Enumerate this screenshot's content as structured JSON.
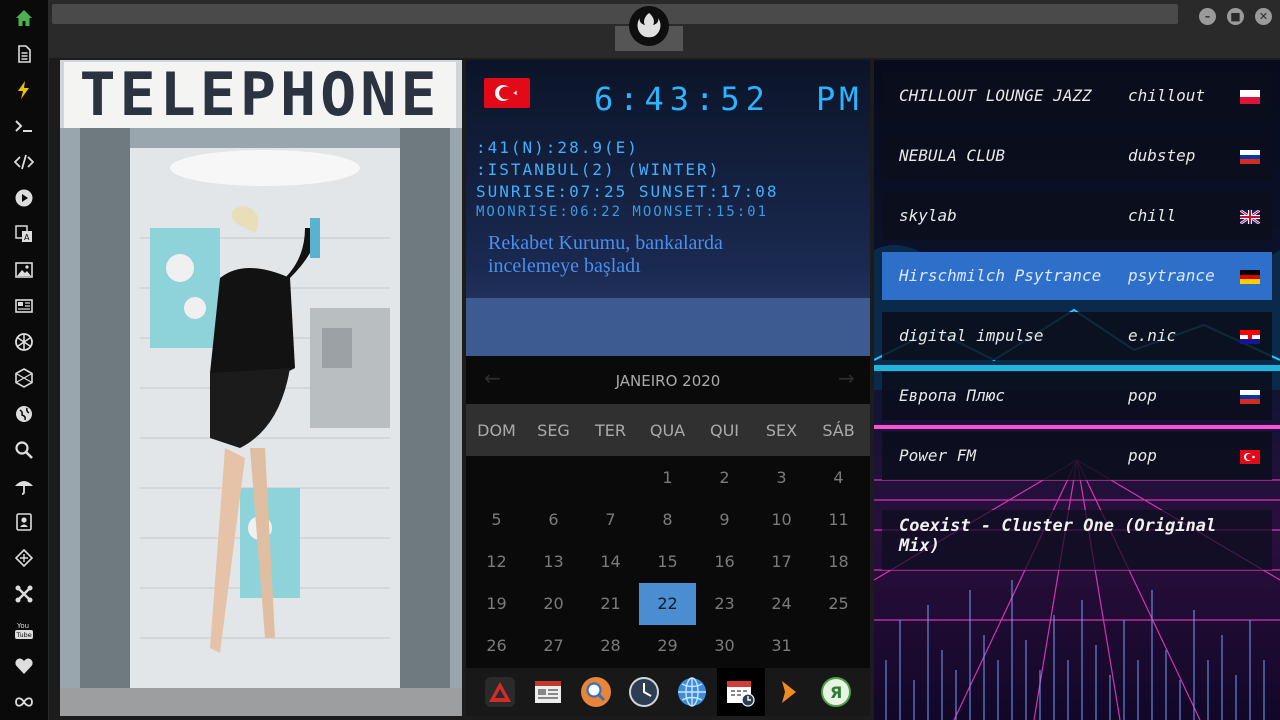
{
  "sidebar": {
    "icons": [
      "home-icon",
      "document-icon",
      "lightning-icon",
      "terminal-icon",
      "code-icon",
      "play-icon",
      "translate-icon",
      "image-icon",
      "news-icon",
      "rebel-icon",
      "hexagon-icon",
      "globe-icon",
      "search-icon",
      "umbrella-icon",
      "contacts-icon",
      "network-icon",
      "tools-icon",
      "youtube-icon",
      "heart-icon",
      "infinity-icon"
    ],
    "youtube_label": "You Tube"
  },
  "photo": {
    "sign_text": "TELEPHONE"
  },
  "clock": {
    "flag": "turkey-flag",
    "time": "6:43:52",
    "ampm": "PM",
    "coords": ":41(N):28.9(E)",
    "place": ":ISTANBUL(2) (WINTER)",
    "sun": "SUNRISE:07:25 SUNSET:17:08",
    "moon": "MOONRISE:06:22 MOONSET:15:01",
    "headline_1": "Rekabet Kurumu, bankalarda",
    "headline_2": "incelemeye başladı",
    "color": "#2bb4ff"
  },
  "calendar": {
    "month": "JANEIRO 2020",
    "prev": "←",
    "next": "→",
    "dows": [
      "DOM",
      "SEG",
      "TER",
      "QUA",
      "QUI",
      "SEX",
      "SÁB"
    ],
    "weeks": [
      [
        "",
        "",
        "",
        "1",
        "2",
        "3",
        "4"
      ],
      [
        "5",
        "6",
        "7",
        "8",
        "9",
        "10",
        "11"
      ],
      [
        "12",
        "13",
        "14",
        "15",
        "16",
        "17",
        "18"
      ],
      [
        "19",
        "20",
        "21",
        "22",
        "23",
        "24",
        "25"
      ],
      [
        "26",
        "27",
        "28",
        "29",
        "30",
        "31",
        ""
      ]
    ],
    "today": "22",
    "today_color": "#4a8dd0"
  },
  "dock": {
    "apps": [
      "warning-app-icon",
      "newspaper-app-icon",
      "search-app-icon",
      "clock-app-icon",
      "browser-app-icon",
      "calendar-app-icon",
      "media-play-app-icon",
      "yandex-app-icon"
    ],
    "yandex_letter": "Я"
  },
  "radio": {
    "stations": [
      {
        "name": "CHILLOUT LOUNGE JAZZ",
        "genre": "chillout",
        "flag": "poland-flag"
      },
      {
        "name": "NEBULA CLUB",
        "genre": "dubstep",
        "flag": "russia-flag"
      },
      {
        "name": "skylab",
        "genre": "chill",
        "flag": "uk-flag"
      },
      {
        "name": "Hirschmilch Psytrance",
        "genre": "psytrance",
        "flag": "germany-flag"
      },
      {
        "name": "digital impulse",
        "genre": "e.nic",
        "flag": "croatia-flag"
      },
      {
        "name": "Европа Плюс",
        "genre": "pop",
        "flag": "russia-flag"
      },
      {
        "name": "Power FM",
        "genre": "pop",
        "flag": "turkey-flag"
      }
    ],
    "active_index": 3,
    "now_playing": "Coexist - Cluster One (Original Mix)",
    "accent": "#2d6fc9"
  }
}
